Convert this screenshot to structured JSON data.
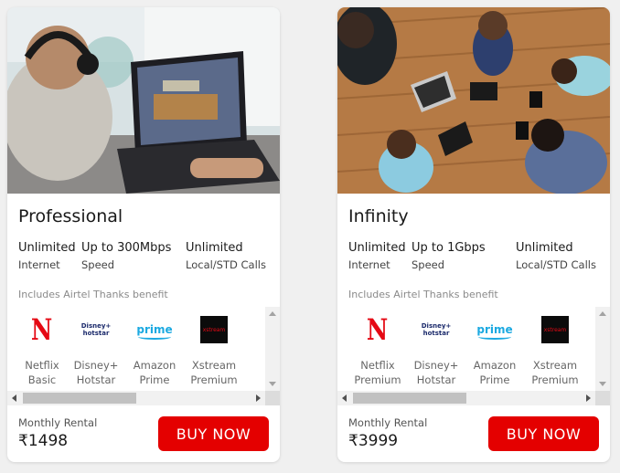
{
  "plans": [
    {
      "title": "Professional",
      "specs": [
        {
          "value": "Unlimited",
          "label": "Internet"
        },
        {
          "value": "Up to 300Mbps",
          "label": "Speed"
        },
        {
          "value": "Unlimited",
          "label": "Local/STD Calls"
        }
      ],
      "benefit_text": "Includes Airtel Thanks benefit",
      "ott": [
        {
          "name": "Netflix Basic",
          "icon": "netflix-icon"
        },
        {
          "name": "Disney+ Hotstar",
          "icon": "disney-hotstar-icon"
        },
        {
          "name": "Amazon Prime",
          "icon": "amazon-prime-icon"
        },
        {
          "name": "Xstream Premium",
          "icon": "xstream-icon"
        }
      ],
      "rental_label": "Monthly Rental",
      "price": "₹1498",
      "cta": "BUY NOW"
    },
    {
      "title": "Infinity",
      "specs": [
        {
          "value": "Unlimited",
          "label": "Internet"
        },
        {
          "value": "Up to 1Gbps",
          "label": "Speed"
        },
        {
          "value": "Unlimited",
          "label": "Local/STD Calls"
        }
      ],
      "benefit_text": "Includes Airtel Thanks benefit",
      "ott": [
        {
          "name": "Netflix Premium",
          "icon": "netflix-icon"
        },
        {
          "name": "Disney+ Hotstar",
          "icon": "disney-hotstar-icon"
        },
        {
          "name": "Amazon Prime",
          "icon": "amazon-prime-icon"
        },
        {
          "name": "Xstream Premium",
          "icon": "xstream-icon"
        }
      ],
      "rental_label": "Monthly Rental",
      "price": "₹3999",
      "cta": "BUY NOW"
    }
  ],
  "logos": {
    "netflix": "N",
    "hotstar": "Disney+ hotstar",
    "prime": "prime",
    "xstream": "xstream"
  },
  "colors": {
    "accent": "#e40000",
    "netflix": "#e50914",
    "prime": "#1ba9e1",
    "page_bg": "#f0f0f0",
    "card_bg": "#ffffff"
  }
}
